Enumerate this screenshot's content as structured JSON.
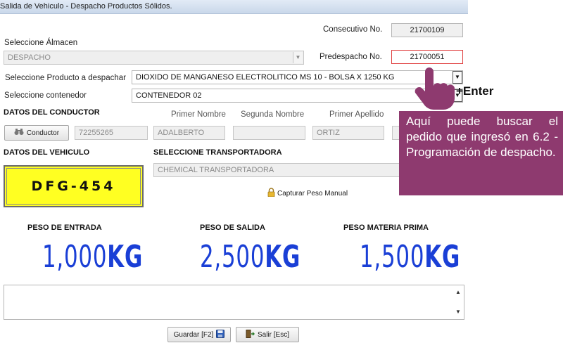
{
  "window": {
    "title": "Salida de Vehiculo - Despacho Productos Sólidos."
  },
  "consecutivo": {
    "label": "Consecutivo No.",
    "value": "21700109"
  },
  "predespacho": {
    "label": "Predespacho No.",
    "value": "21700051"
  },
  "almacen": {
    "label": "Seleccione Álmacen",
    "value": "DESPACHO"
  },
  "producto": {
    "label": "Seleccione Producto a despachar",
    "value": "DIOXIDO DE MANGANESO ELECTROLITICO MS 10 - BOLSA X 1250 KG"
  },
  "contenedor": {
    "label": "Seleccione contenedor",
    "value": "CONTENEDOR 02"
  },
  "conductor": {
    "section_title": "DATOS DEL CONDUCTOR",
    "button_label": "Conductor",
    "id_value": "72255265",
    "primer_nombre_label": "Primer Nombre",
    "primer_nombre_value": "ADALBERTO",
    "segundo_nombre_label": "Segunda Nombre",
    "segundo_nombre_value": "",
    "primer_apellido_label": "Primer Apellido",
    "primer_apellido_value": "ORTIZ"
  },
  "vehiculo": {
    "section_title": "DATOS DEL VEHICULO",
    "plate": "DFG-454"
  },
  "transportadora": {
    "label": "SELECCIONE TRANSPORTADORA",
    "value": "CHEMICAL TRANSPORTADORA"
  },
  "capturar_peso": {
    "label": "Capturar Peso Manual"
  },
  "pesos": {
    "entrada": {
      "label": "PESO DE ENTRADA",
      "number": "1,000",
      "unit": "KG"
    },
    "salida": {
      "label": "PESO DE SALIDA",
      "number": "2,500",
      "unit": "KG"
    },
    "materia_prima": {
      "label": "PESO MATERIA PRIMA",
      "number": "1,500",
      "unit": "KG"
    }
  },
  "buttons": {
    "guardar": "Guardar [F2]",
    "salir": "Salir [Esc]"
  },
  "annotation": {
    "enter_label": "+Enter",
    "callout_text": "Aquí puede buscar el pedido que ingresó en 6.2 - Programación de despacho."
  },
  "colors": {
    "weight_blue": "#1a3fd6",
    "callout_bg": "#8e3a6f",
    "plate_yellow": "#ffff22",
    "highlight_border": "#e04040"
  },
  "icons": [
    "binoculars-icon",
    "lock-icon",
    "floppy-disk-icon",
    "exit-door-icon",
    "pointing-hand-icon",
    "dropdown-arrow-icon",
    "scroll-up-icon",
    "scroll-down-icon"
  ]
}
